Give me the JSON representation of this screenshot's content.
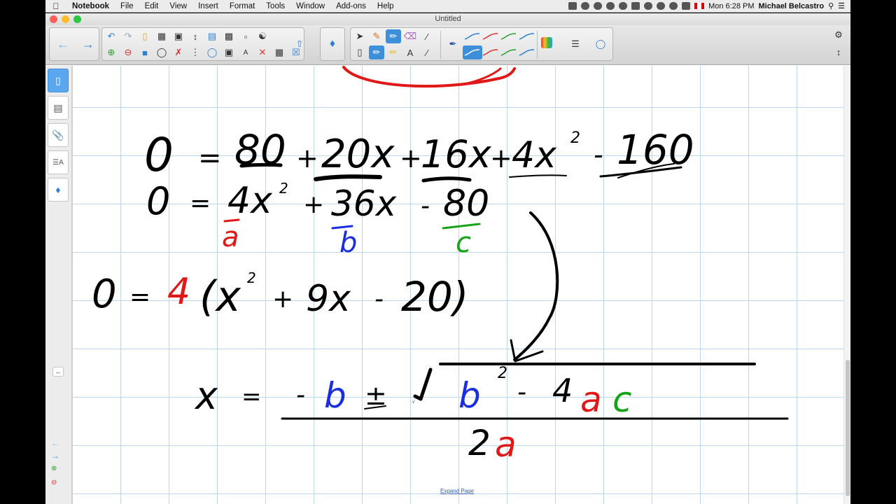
{
  "menubar": {
    "app_name": "Notebook",
    "menus": [
      "File",
      "Edit",
      "View",
      "Insert",
      "Format",
      "Tools",
      "Window",
      "Add-ons",
      "Help"
    ],
    "clock": "Mon 6:28 PM",
    "user": "Michael Belcastro"
  },
  "window": {
    "title": "Untitled"
  },
  "toolbar": {
    "back_icon": "arrow-left-icon",
    "forward_icon": "arrow-right-icon",
    "selected_tool": "pen"
  },
  "sidebar": {
    "tabs": [
      "page-sorter",
      "gallery",
      "attachments",
      "properties",
      "add-ons"
    ],
    "selected": "page-sorter"
  },
  "canvas": {
    "expand_label": "Expand Page",
    "line1": [
      "0",
      "=",
      "80",
      "+",
      "20x",
      "+",
      "16x",
      "+",
      "4x",
      "2",
      "-",
      "160"
    ],
    "line2": [
      "0",
      "=",
      "4x",
      "2",
      "+",
      "36x",
      "-",
      "80"
    ],
    "coeffs": {
      "a": "a",
      "b": "b",
      "c": "c"
    },
    "line3": [
      "0",
      "=",
      "4",
      "(x",
      "2",
      "+",
      "9x",
      "-",
      "20)"
    ],
    "formula": [
      "x",
      "=",
      "-",
      "b",
      "±",
      "√",
      "b",
      "2",
      "-",
      "4",
      "a",
      "c",
      "2",
      "a"
    ]
  },
  "colors": {
    "ink": "#000000",
    "red": "#e01818",
    "blue": "#1a2ee0",
    "green": "#17a317",
    "accent": "#3d8fd9",
    "grid": "#bcd6ee"
  }
}
